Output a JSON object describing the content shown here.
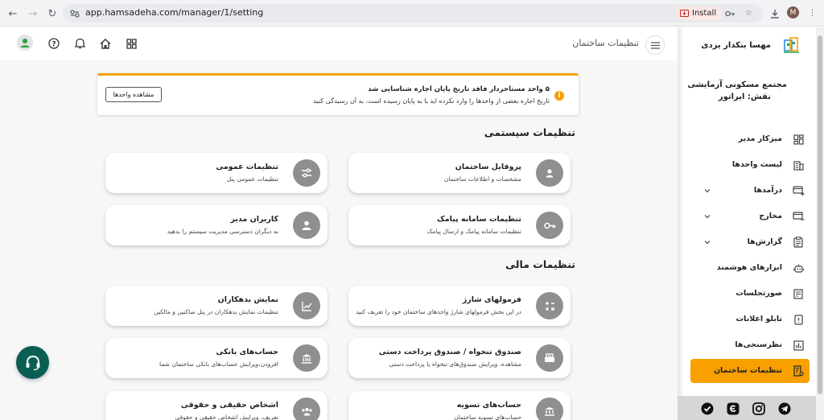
{
  "browser": {
    "url": "app.hamsadeha.com/manager/1/setting",
    "install_label": "Install",
    "profile_initial": "M"
  },
  "header": {
    "page_title": "تنظیمات ساختمان"
  },
  "alert": {
    "title": "۵ واحد مستاجردار فاقد تاریخ پایان اجاره شناسایی شد",
    "text": "تاریخ اجاره بعضی از واحدها را وارد نکرده اید یا به پایان رسیده است، به آن رسیدگی کنید",
    "button_label": "مشاهده واحدها",
    "accent": "#f7a000"
  },
  "sections": [
    {
      "title": "تنظیمات سیستمی",
      "cards": [
        {
          "title": "پروفایل ساختمان",
          "desc": "مشخصات و اطلاعات ساختمان",
          "icon": "building-profile-icon"
        },
        {
          "title": "تنظیمات عمومی",
          "desc": "تنظیمات عمومی پنل",
          "icon": "sliders-icon"
        },
        {
          "title": "تنظیمات سامانه پیامک",
          "desc": "تنظیمات سامانه پیامک و ارسال پیامک",
          "icon": "key-icon"
        },
        {
          "title": "کاربران مدیر",
          "desc": "به دیگران دسترسی مدیریت سیستم را بدهید",
          "icon": "user-icon"
        }
      ]
    },
    {
      "title": "تنظیمات مالی",
      "cards": [
        {
          "title": "فرمولهای شارژ",
          "desc": "در این بخش فرمولهای شارژ واحدهای ساختمان خود را تعریف کنید",
          "icon": "calculator-icon"
        },
        {
          "title": "نمایش بدهکاران",
          "desc": "تنظیمات نمایش بدهکاران در پنل ساکنین و مالکین",
          "icon": "chart-icon"
        },
        {
          "title": "صندوق تنخواه / صندوق پرداخت دستی",
          "desc": "مشاهده، ویرایش صندوق‌های تنخواه یا پرداخت دستی",
          "icon": "cash-box-icon"
        },
        {
          "title": "حساب‌های بانکی",
          "desc": "افزودن،ویرایش حساب‌های بانکی ساختمان شما",
          "icon": "bank-icon"
        },
        {
          "title": "حساب‌های تسویه",
          "desc": "حساب‌های تسویه ساختمان",
          "icon": "settlement-icon"
        },
        {
          "title": "اشخاص حقیقی و حقوقی",
          "desc": "تعریف، ویرایش اشخاص حقیقی و حقوقی",
          "icon": "people-icon"
        }
      ]
    }
  ],
  "sidebar": {
    "owner_name": "مهسا بنکدار یزدی",
    "complex_name": "مجتمع مسکونی آزمایشی",
    "role": "نقش: اپراتور",
    "items": [
      {
        "label": "میزکار مدیر",
        "icon": "dashboard-icon",
        "expandable": false,
        "active": false
      },
      {
        "label": "لیست واحدها",
        "icon": "units-icon",
        "expandable": false,
        "active": false
      },
      {
        "label": "درآمدها",
        "icon": "income-icon",
        "expandable": true,
        "active": false
      },
      {
        "label": "مخارج",
        "icon": "expense-icon",
        "expandable": true,
        "active": false
      },
      {
        "label": "گزارش‌ها",
        "icon": "report-icon",
        "expandable": true,
        "active": false
      },
      {
        "label": "ابزارهای هوشمند",
        "icon": "robot-icon",
        "expandable": false,
        "active": false
      },
      {
        "label": "صورتجلسات",
        "icon": "minutes-icon",
        "expandable": false,
        "active": false
      },
      {
        "label": "تابلو اعلانات",
        "icon": "notice-board-icon",
        "expandable": false,
        "active": false
      },
      {
        "label": "نظرسنجی‌ها",
        "icon": "poll-icon",
        "expandable": false,
        "active": false
      },
      {
        "label": "تنظیمات ساختمان",
        "icon": "building-settings-icon",
        "expandable": false,
        "active": true
      }
    ],
    "active_color": "#f7a000"
  },
  "social": [
    "telegram-icon",
    "instagram-icon",
    "eitaa-icon",
    "bale-icon"
  ]
}
